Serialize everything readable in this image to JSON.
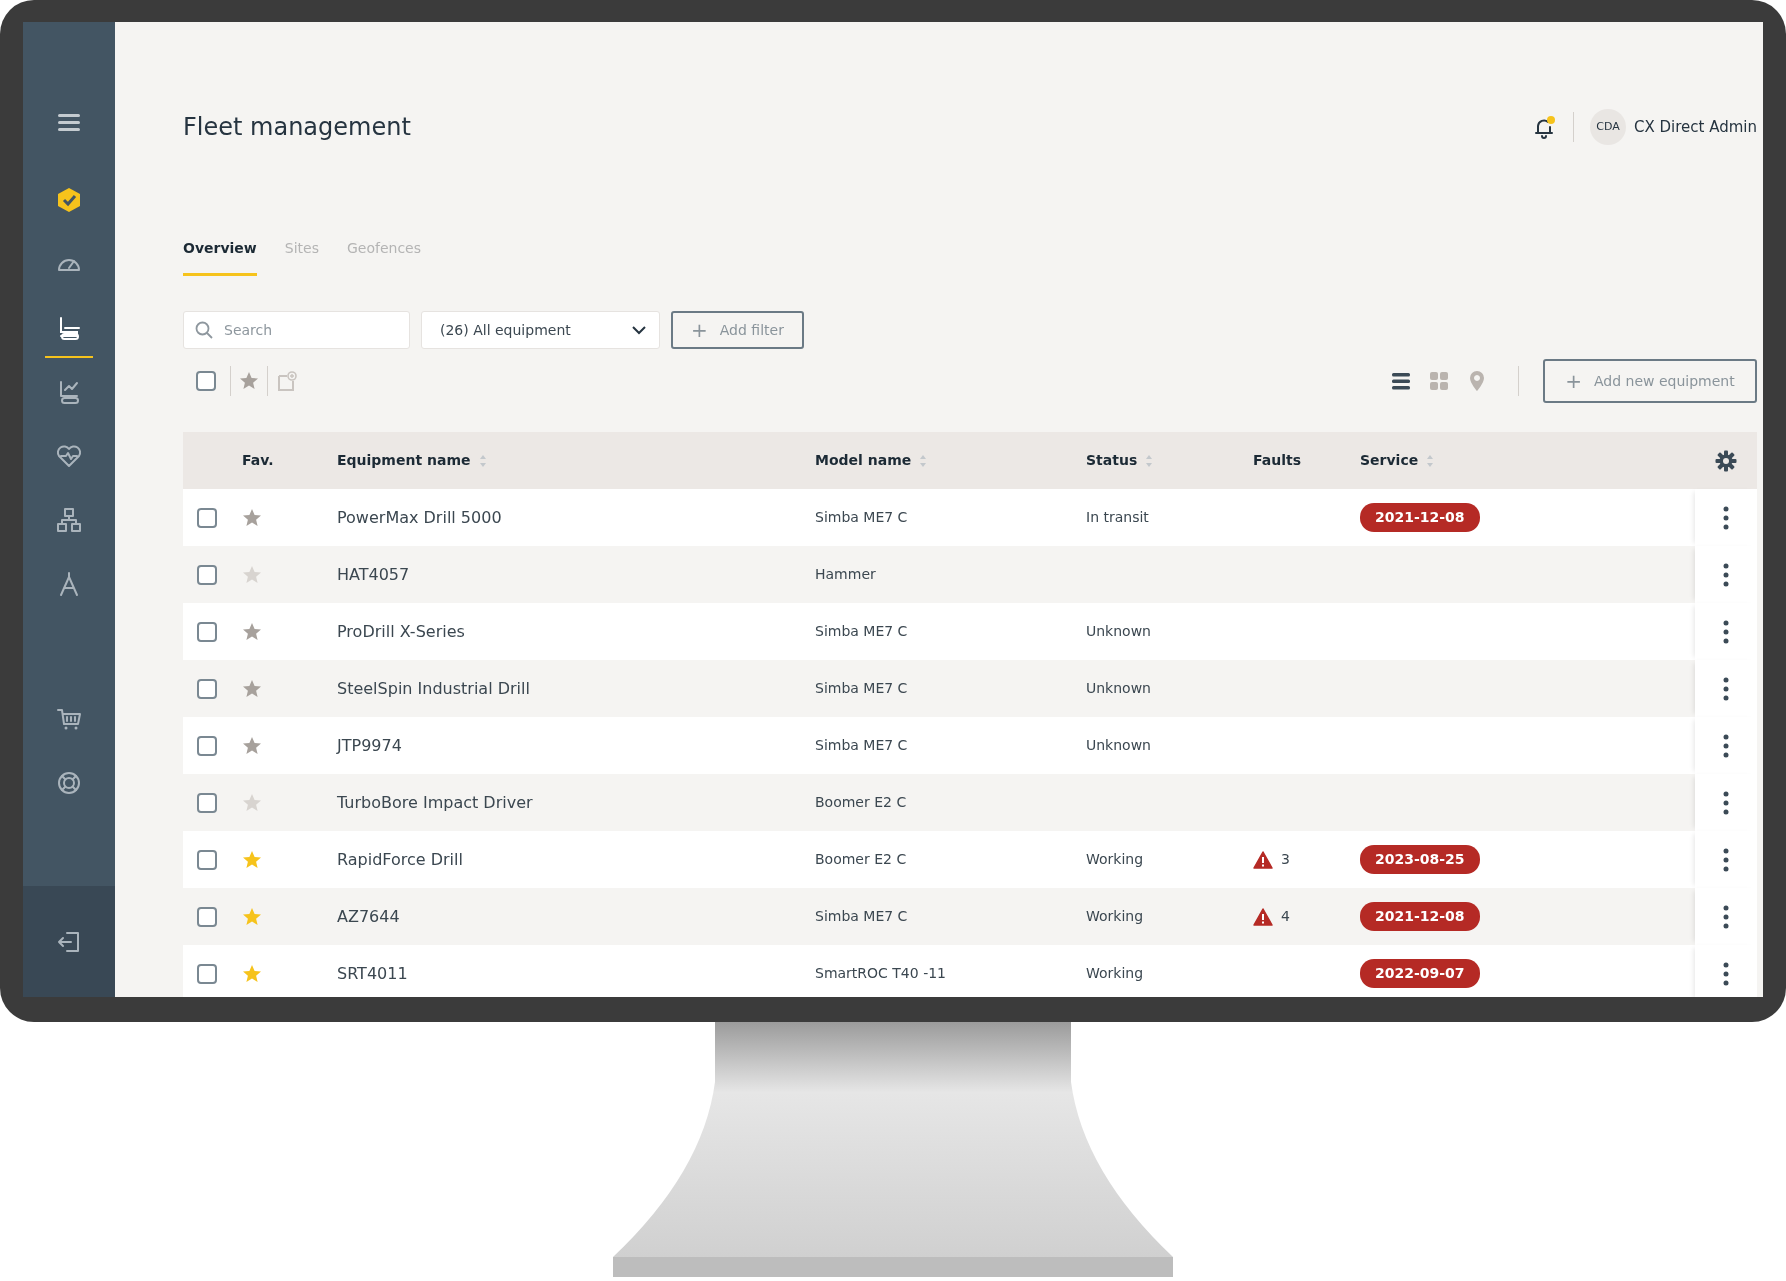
{
  "sidebar": {
    "items": [
      {
        "kind": "menu",
        "selected": false
      },
      {
        "kind": "logo",
        "selected": false
      },
      {
        "kind": "gauge",
        "selected": false
      },
      {
        "kind": "machine",
        "selected": true
      },
      {
        "kind": "machine-chart",
        "selected": false
      },
      {
        "kind": "heart",
        "selected": false
      },
      {
        "kind": "network",
        "selected": false
      },
      {
        "kind": "compass",
        "selected": false
      },
      {
        "kind": "cart",
        "selected": false
      },
      {
        "kind": "lifebuoy",
        "selected": false
      }
    ],
    "footer": {
      "kind": "logout"
    }
  },
  "page_title": "Fleet management",
  "notifications": {
    "unread": true
  },
  "user": {
    "initials": "CDA",
    "name": "CX Direct Admin"
  },
  "tabs": [
    {
      "label": "Overview",
      "selected": true
    },
    {
      "label": "Sites",
      "selected": false
    },
    {
      "label": "Geofences",
      "selected": false
    }
  ],
  "search": {
    "placeholder": "Search"
  },
  "equipment_filter": {
    "value": "(26) All equipment"
  },
  "add_filter": {
    "icon": "+",
    "label": "Add filter"
  },
  "bulk": {
    "checked": false
  },
  "view_modes": [
    {
      "kind": "list",
      "selected": true
    },
    {
      "kind": "grid",
      "selected": false
    },
    {
      "kind": "map",
      "selected": false
    }
  ],
  "add_equipment": {
    "icon": "+",
    "label": "Add new equipment"
  },
  "table": {
    "columns": [
      {
        "label": "Fav.",
        "sortable": false
      },
      {
        "label": "Equipment name",
        "sortable": true
      },
      {
        "label": "Model name",
        "sortable": true
      },
      {
        "label": "Status",
        "sortable": true
      },
      {
        "label": "Faults",
        "sortable": false
      },
      {
        "label": "Service",
        "sortable": true
      }
    ],
    "rows": [
      {
        "checked": false,
        "favorite": false,
        "star_disabled": false,
        "name": "PowerMax Drill 5000",
        "model": "Simba ME7 C",
        "status": "In transit",
        "service": "2021-12-08"
      },
      {
        "checked": false,
        "favorite": false,
        "star_disabled": true,
        "name": "HAT4057",
        "model": "Hammer"
      },
      {
        "checked": false,
        "favorite": false,
        "star_disabled": false,
        "name": "ProDrill X-Series",
        "model": "Simba ME7 C",
        "status": "Unknown"
      },
      {
        "checked": false,
        "favorite": false,
        "star_disabled": false,
        "name": "SteelSpin Industrial Drill",
        "model": "Simba ME7 C",
        "status": "Unknown"
      },
      {
        "checked": false,
        "favorite": false,
        "star_disabled": false,
        "name": "JTP9974",
        "model": "Simba ME7 C",
        "status": "Unknown"
      },
      {
        "checked": false,
        "favorite": false,
        "star_disabled": true,
        "name": "TurboBore Impact Driver",
        "model": "Boomer E2 C"
      },
      {
        "checked": false,
        "favorite": true,
        "star_disabled": false,
        "name": "RapidForce Drill",
        "model": "Boomer E2 C",
        "status": "Working",
        "faults": "3",
        "service": "2023-08-25"
      },
      {
        "checked": false,
        "favorite": true,
        "star_disabled": false,
        "name": "AZ7644",
        "model": "Simba ME7 C",
        "status": "Working",
        "faults": "4",
        "service": "2021-12-08"
      },
      {
        "checked": false,
        "favorite": true,
        "star_disabled": false,
        "name": "SRT4011",
        "model": "SmartROC T40 -11",
        "status": "Working",
        "service": "2022-09-07"
      }
    ]
  }
}
